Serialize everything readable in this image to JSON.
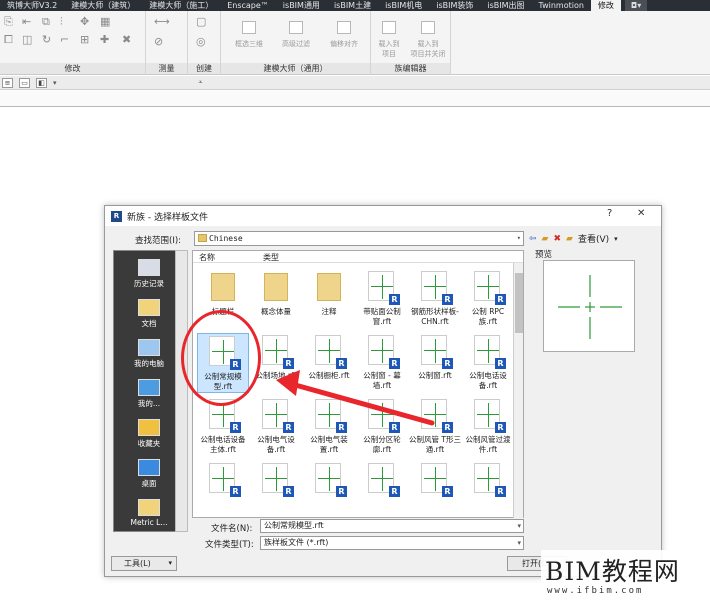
{
  "ribbon": {
    "tabs": [
      "筑博大师V3.2",
      "建模大师（建筑）",
      "建模大师（施工）",
      "Enscape™",
      "isBIM通用",
      "isBIM土建",
      "isBIM机电",
      "isBIM装饰",
      "isBIM出图",
      "Twinmotion",
      "修改"
    ],
    "active_tab": "修改",
    "groups": {
      "modify": "修改",
      "measure": "测量",
      "create": "创建",
      "modeling_master": "建模大师（通用）",
      "family_editor": "族编辑器"
    },
    "buttons": {
      "show_3d": "框选三维",
      "advanced_filter": "高级过滤",
      "offset_align": "偏移对齐",
      "load_to_project": "载入到\n项目",
      "load_and_close": "载入到\n项目并关闭"
    }
  },
  "dialog": {
    "title": "新族 - 选择样板文件",
    "help": "?",
    "close": "✕",
    "look_in_label": "查找范围(I):",
    "look_in_value": "Chinese",
    "view_label": "查看(V)",
    "preview_label": "预览",
    "places": [
      "历史记录",
      "文档",
      "我的电脑",
      "我的...",
      "收藏夹",
      "桌面",
      "Metric L..."
    ],
    "columns": {
      "name": "名称",
      "type": "类型"
    },
    "files": [
      {
        "name": "标题栏",
        "kind": "folder"
      },
      {
        "name": "概念体量",
        "kind": "folder"
      },
      {
        "name": "注释",
        "kind": "folder"
      },
      {
        "name": "带贴面公制窗.rft",
        "kind": "rft"
      },
      {
        "name": "钢筋形状样板-CHN.rft",
        "kind": "rft"
      },
      {
        "name": "公制 RPC 族.rft",
        "kind": "rft"
      },
      {
        "name": "公制常规模型.rft",
        "kind": "rft",
        "selected": true
      },
      {
        "name": "公制场地.rft",
        "kind": "rft"
      },
      {
        "name": "公制橱柜.rft",
        "kind": "rft"
      },
      {
        "name": "公制窗 - 幕墙.rft",
        "kind": "rft"
      },
      {
        "name": "公制窗.rft",
        "kind": "rft"
      },
      {
        "name": "公制电话设备.rft",
        "kind": "rft"
      },
      {
        "name": "公制电话设备主体.rft",
        "kind": "rft"
      },
      {
        "name": "公制电气设备.rft",
        "kind": "rft"
      },
      {
        "name": "公制电气装置.rft",
        "kind": "rft"
      },
      {
        "name": "公制分区轮廓.rft",
        "kind": "rft"
      },
      {
        "name": "公制风管 T形三通.rft",
        "kind": "rft"
      },
      {
        "name": "公制风管过渡件.rft",
        "kind": "rft"
      },
      {
        "name": "",
        "kind": "rft"
      },
      {
        "name": "",
        "kind": "rft"
      },
      {
        "name": "",
        "kind": "rft"
      },
      {
        "name": "",
        "kind": "rft"
      },
      {
        "name": "",
        "kind": "rft"
      },
      {
        "name": "",
        "kind": "rft"
      }
    ],
    "file_name_label": "文件名(N):",
    "file_name_value": "公制常规模型.rft",
    "file_type_label": "文件类型(T):",
    "file_type_value": "族样板文件 (*.rft)",
    "tools_button": "工具(L)",
    "open_button": "打开(O)"
  },
  "watermark": {
    "main": "BIM教程网",
    "url": "www.ifbim.com"
  },
  "colors": {
    "annotation_red": "#e8262c",
    "badge_blue": "#1f57b6",
    "template_green": "#2f9a3a"
  }
}
